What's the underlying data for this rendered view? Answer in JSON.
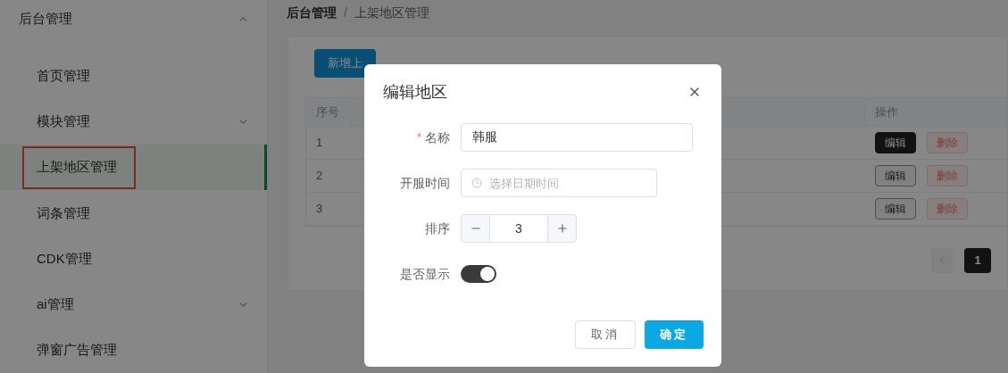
{
  "sidebar": {
    "group": {
      "label": "后台管理",
      "expanded": true
    },
    "items": [
      {
        "label": "首页管理",
        "expandable": false,
        "selected": false,
        "highlighted": false
      },
      {
        "label": "模块管理",
        "expandable": true,
        "selected": false,
        "highlighted": false
      },
      {
        "label": "上架地区管理",
        "expandable": false,
        "selected": true,
        "highlighted": true
      },
      {
        "label": "词条管理",
        "expandable": false,
        "selected": false,
        "highlighted": false
      },
      {
        "label": "CDK管理",
        "expandable": false,
        "selected": false,
        "highlighted": false
      },
      {
        "label": "ai管理",
        "expandable": true,
        "selected": false,
        "highlighted": false
      },
      {
        "label": "弹窗广告管理",
        "expandable": false,
        "selected": false,
        "highlighted": false
      }
    ]
  },
  "breadcrumb": [
    "后台管理",
    "上架地区管理"
  ],
  "breadcrumb_separator": "/",
  "add_button": "新增上",
  "table": {
    "columns": [
      "序号",
      "操作"
    ],
    "rows": [
      {
        "cells": [
          "1"
        ],
        "actions": [
          {
            "label": "编辑",
            "kind": "edit",
            "active": true
          },
          {
            "label": "删除",
            "kind": "delete"
          }
        ]
      },
      {
        "cells": [
          "2"
        ],
        "actions": [
          {
            "label": "编辑",
            "kind": "edit",
            "active": false
          },
          {
            "label": "删除",
            "kind": "delete"
          }
        ]
      },
      {
        "cells": [
          "3"
        ],
        "actions": [
          {
            "label": "编辑",
            "kind": "edit",
            "active": false
          },
          {
            "label": "删除",
            "kind": "delete"
          }
        ]
      }
    ]
  },
  "pagination": {
    "pages": [
      {
        "label": "1",
        "selected": true
      }
    ]
  },
  "dialog": {
    "title": "编辑地区",
    "fields": [
      {
        "kind": "text",
        "label": "名称",
        "mark": "*",
        "value": "韩服"
      },
      {
        "kind": "datetime",
        "label": "开服时间",
        "placeholder": "选择日期时间"
      },
      {
        "kind": "number",
        "label": "排序",
        "value": "3"
      },
      {
        "kind": "switch",
        "label": "是否显示",
        "on": true
      }
    ],
    "buttons": [
      {
        "label": "取消",
        "kind": "secondary"
      },
      {
        "label": "确定",
        "kind": "primary"
      }
    ]
  }
}
